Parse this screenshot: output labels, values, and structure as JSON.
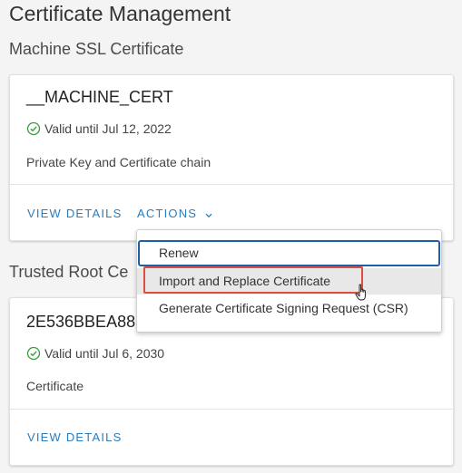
{
  "page": {
    "title": "Certificate Management"
  },
  "machine_ssl": {
    "section_title": "Machine SSL Certificate",
    "card": {
      "name": "__MACHINE_CERT",
      "validity": "Valid until Jul 12, 2022",
      "description": "Private Key and Certificate chain",
      "view_details_label": "VIEW DETAILS",
      "actions_label": "ACTIONS"
    }
  },
  "trusted_root": {
    "section_title": "Trusted Root Ce",
    "card": {
      "name": "2E536BBEA88",
      "validity": "Valid until Jul 6, 2030",
      "description": "Certificate",
      "view_details_label": "VIEW DETAILS"
    }
  },
  "actions_menu": {
    "items": [
      {
        "label": "Renew",
        "state": "focused"
      },
      {
        "label": "Import and Replace Certificate",
        "state": "hovered"
      },
      {
        "label": "Generate Certificate Signing Request (CSR)",
        "state": "normal"
      }
    ]
  },
  "colors": {
    "link": "#2b7dbc",
    "valid_check": "#3a9b3a",
    "focus_border": "#1f5fa8",
    "highlight_annotation": "#d9503f"
  },
  "icons": {
    "valid": "check-circle-icon",
    "dropdown": "chevron-down-icon",
    "pointer": "hand-pointer-icon"
  }
}
